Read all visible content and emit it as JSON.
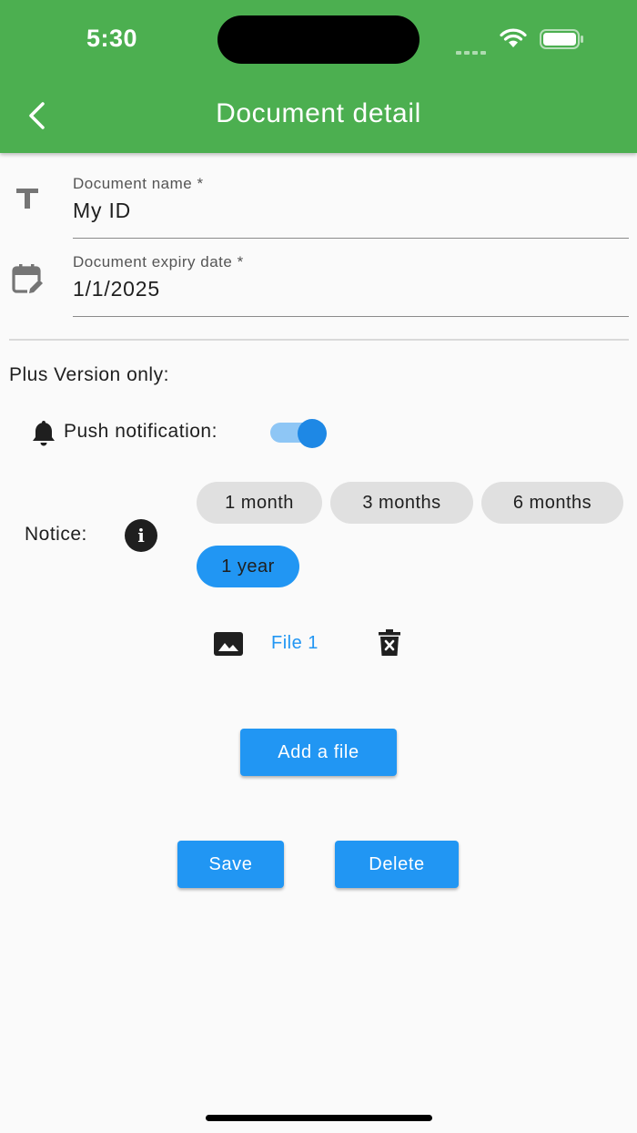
{
  "status_bar": {
    "time": "5:30"
  },
  "appbar": {
    "title": "Document detail"
  },
  "form": {
    "name_label": "Document name *",
    "name_value": "My ID",
    "expiry_label": "Document expiry date *",
    "expiry_value": "1/1/2025"
  },
  "plus": {
    "title": "Plus Version only:",
    "push_label": "Push notification:",
    "push_enabled": true,
    "notice_label": "Notice:",
    "notice_options": [
      "1 month",
      "3 months",
      "6 months",
      "1 year"
    ],
    "notice_selected": "1 year"
  },
  "files": [
    {
      "label": "File 1",
      "icon": "image-icon"
    }
  ],
  "buttons": {
    "add_file": "Add a file",
    "save": "Save",
    "delete": "Delete"
  },
  "colors": {
    "appbar": "#4caf50",
    "accent": "#2196f3",
    "chip": "#e0e0e0"
  }
}
